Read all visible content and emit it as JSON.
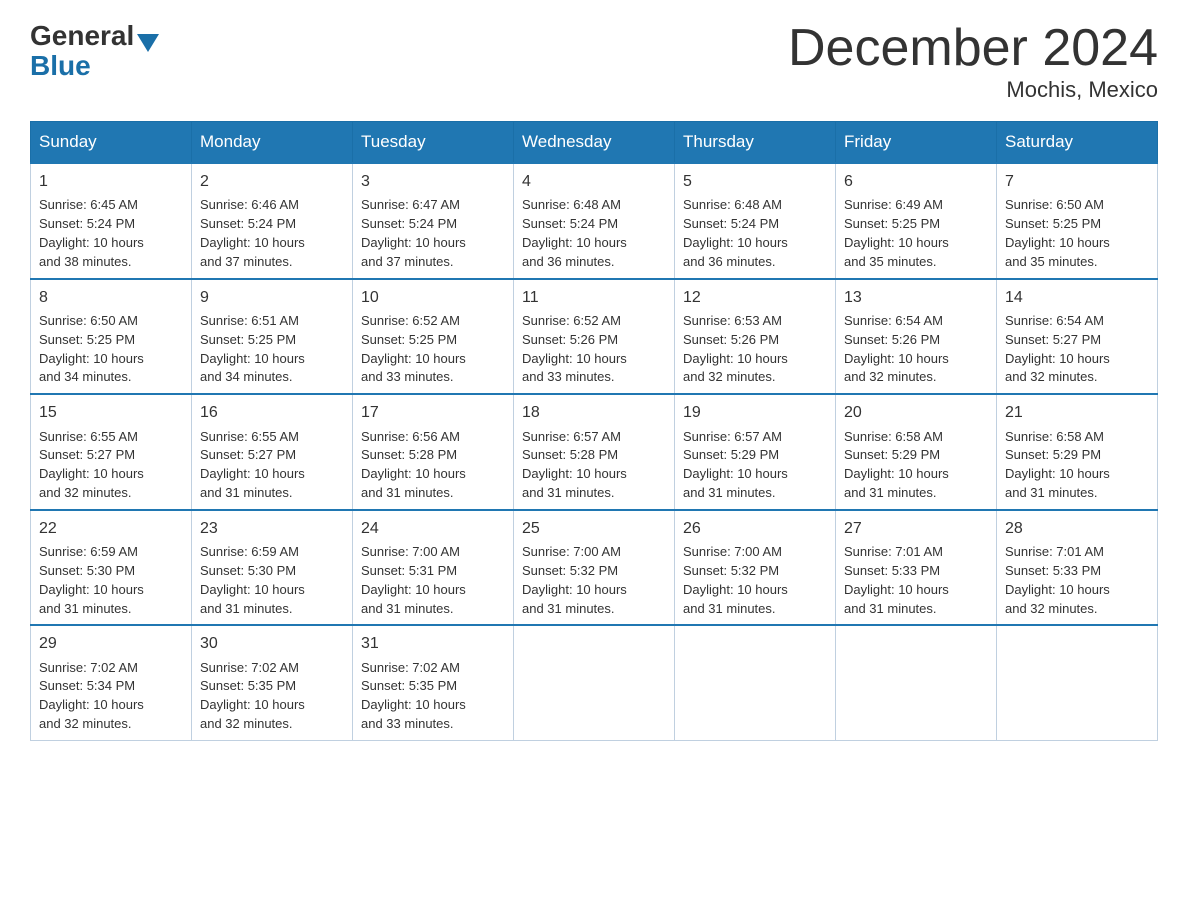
{
  "logo": {
    "general": "General",
    "blue": "Blue"
  },
  "title": "December 2024",
  "subtitle": "Mochis, Mexico",
  "days": [
    "Sunday",
    "Monday",
    "Tuesday",
    "Wednesday",
    "Thursday",
    "Friday",
    "Saturday"
  ],
  "weeks": [
    [
      {
        "date": "1",
        "sunrise": "6:45 AM",
        "sunset": "5:24 PM",
        "daylight": "10 hours and 38 minutes."
      },
      {
        "date": "2",
        "sunrise": "6:46 AM",
        "sunset": "5:24 PM",
        "daylight": "10 hours and 37 minutes."
      },
      {
        "date": "3",
        "sunrise": "6:47 AM",
        "sunset": "5:24 PM",
        "daylight": "10 hours and 37 minutes."
      },
      {
        "date": "4",
        "sunrise": "6:48 AM",
        "sunset": "5:24 PM",
        "daylight": "10 hours and 36 minutes."
      },
      {
        "date": "5",
        "sunrise": "6:48 AM",
        "sunset": "5:24 PM",
        "daylight": "10 hours and 36 minutes."
      },
      {
        "date": "6",
        "sunrise": "6:49 AM",
        "sunset": "5:25 PM",
        "daylight": "10 hours and 35 minutes."
      },
      {
        "date": "7",
        "sunrise": "6:50 AM",
        "sunset": "5:25 PM",
        "daylight": "10 hours and 35 minutes."
      }
    ],
    [
      {
        "date": "8",
        "sunrise": "6:50 AM",
        "sunset": "5:25 PM",
        "daylight": "10 hours and 34 minutes."
      },
      {
        "date": "9",
        "sunrise": "6:51 AM",
        "sunset": "5:25 PM",
        "daylight": "10 hours and 34 minutes."
      },
      {
        "date": "10",
        "sunrise": "6:52 AM",
        "sunset": "5:25 PM",
        "daylight": "10 hours and 33 minutes."
      },
      {
        "date": "11",
        "sunrise": "6:52 AM",
        "sunset": "5:26 PM",
        "daylight": "10 hours and 33 minutes."
      },
      {
        "date": "12",
        "sunrise": "6:53 AM",
        "sunset": "5:26 PM",
        "daylight": "10 hours and 32 minutes."
      },
      {
        "date": "13",
        "sunrise": "6:54 AM",
        "sunset": "5:26 PM",
        "daylight": "10 hours and 32 minutes."
      },
      {
        "date": "14",
        "sunrise": "6:54 AM",
        "sunset": "5:27 PM",
        "daylight": "10 hours and 32 minutes."
      }
    ],
    [
      {
        "date": "15",
        "sunrise": "6:55 AM",
        "sunset": "5:27 PM",
        "daylight": "10 hours and 32 minutes."
      },
      {
        "date": "16",
        "sunrise": "6:55 AM",
        "sunset": "5:27 PM",
        "daylight": "10 hours and 31 minutes."
      },
      {
        "date": "17",
        "sunrise": "6:56 AM",
        "sunset": "5:28 PM",
        "daylight": "10 hours and 31 minutes."
      },
      {
        "date": "18",
        "sunrise": "6:57 AM",
        "sunset": "5:28 PM",
        "daylight": "10 hours and 31 minutes."
      },
      {
        "date": "19",
        "sunrise": "6:57 AM",
        "sunset": "5:29 PM",
        "daylight": "10 hours and 31 minutes."
      },
      {
        "date": "20",
        "sunrise": "6:58 AM",
        "sunset": "5:29 PM",
        "daylight": "10 hours and 31 minutes."
      },
      {
        "date": "21",
        "sunrise": "6:58 AM",
        "sunset": "5:29 PM",
        "daylight": "10 hours and 31 minutes."
      }
    ],
    [
      {
        "date": "22",
        "sunrise": "6:59 AM",
        "sunset": "5:30 PM",
        "daylight": "10 hours and 31 minutes."
      },
      {
        "date": "23",
        "sunrise": "6:59 AM",
        "sunset": "5:30 PM",
        "daylight": "10 hours and 31 minutes."
      },
      {
        "date": "24",
        "sunrise": "7:00 AM",
        "sunset": "5:31 PM",
        "daylight": "10 hours and 31 minutes."
      },
      {
        "date": "25",
        "sunrise": "7:00 AM",
        "sunset": "5:32 PM",
        "daylight": "10 hours and 31 minutes."
      },
      {
        "date": "26",
        "sunrise": "7:00 AM",
        "sunset": "5:32 PM",
        "daylight": "10 hours and 31 minutes."
      },
      {
        "date": "27",
        "sunrise": "7:01 AM",
        "sunset": "5:33 PM",
        "daylight": "10 hours and 31 minutes."
      },
      {
        "date": "28",
        "sunrise": "7:01 AM",
        "sunset": "5:33 PM",
        "daylight": "10 hours and 32 minutes."
      }
    ],
    [
      {
        "date": "29",
        "sunrise": "7:02 AM",
        "sunset": "5:34 PM",
        "daylight": "10 hours and 32 minutes."
      },
      {
        "date": "30",
        "sunrise": "7:02 AM",
        "sunset": "5:35 PM",
        "daylight": "10 hours and 32 minutes."
      },
      {
        "date": "31",
        "sunrise": "7:02 AM",
        "sunset": "5:35 PM",
        "daylight": "10 hours and 33 minutes."
      },
      null,
      null,
      null,
      null
    ]
  ]
}
